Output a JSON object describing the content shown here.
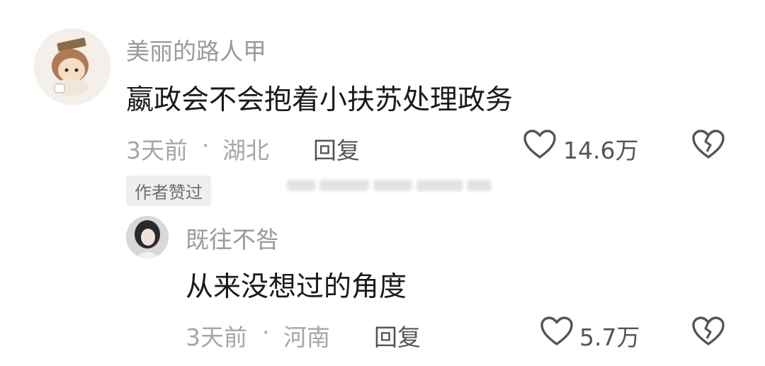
{
  "comments": [
    {
      "user": "美丽的路人甲",
      "text": "嬴政会不会抱着小扶苏处理政务",
      "time": "3天前",
      "location": "湖北",
      "reply_label": "回复",
      "likes": "14.6万",
      "badge": "作者赞过"
    },
    {
      "user": "既往不咎",
      "text": "从来没想过的角度",
      "time": "3天前",
      "location": "河南",
      "reply_label": "回复",
      "likes": "5.7万"
    }
  ],
  "separator": "·",
  "icons": {
    "like": "heart-outline-icon",
    "dislike": "broken-heart-icon"
  },
  "colors": {
    "text": "#1a1a1a",
    "muted": "#9a9a9a",
    "badge_bg": "#efefef"
  }
}
